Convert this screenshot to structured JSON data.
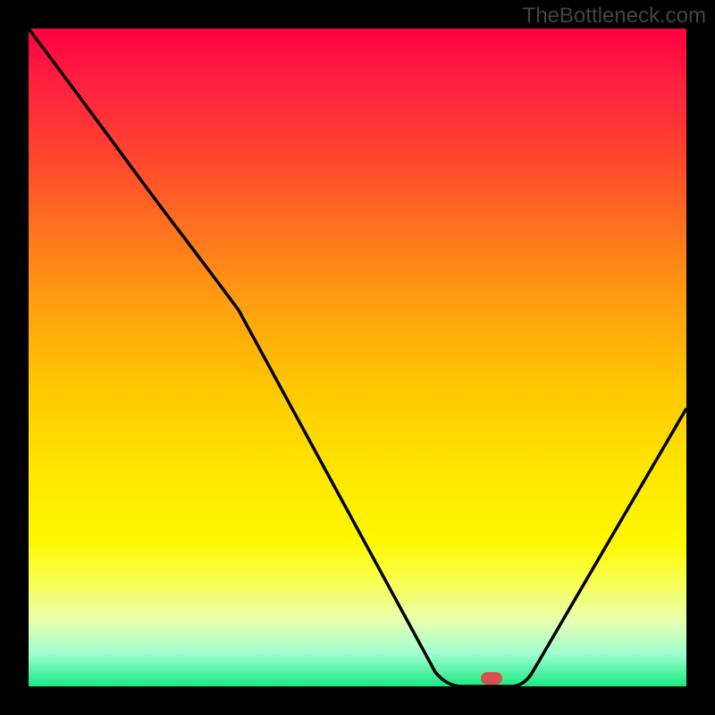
{
  "watermark": "TheBottleneck.com",
  "chart_data": {
    "type": "line",
    "title": "",
    "xlabel": "",
    "ylabel": "",
    "xlim": [
      0,
      100
    ],
    "ylim": [
      0,
      100
    ],
    "curve": [
      {
        "x": 0,
        "y": 100
      },
      {
        "x": 22,
        "y": 70
      },
      {
        "x": 30,
        "y": 60
      },
      {
        "x": 62,
        "y": 2
      },
      {
        "x": 66,
        "y": 0
      },
      {
        "x": 74,
        "y": 0
      },
      {
        "x": 76,
        "y": 2
      },
      {
        "x": 100,
        "y": 42
      }
    ],
    "marker": {
      "x": 71,
      "y": 0,
      "color": "#d85050"
    },
    "gradient_colors": {
      "top": "#ff0040",
      "mid": "#ffd000",
      "bottom": "#18e880"
    }
  }
}
